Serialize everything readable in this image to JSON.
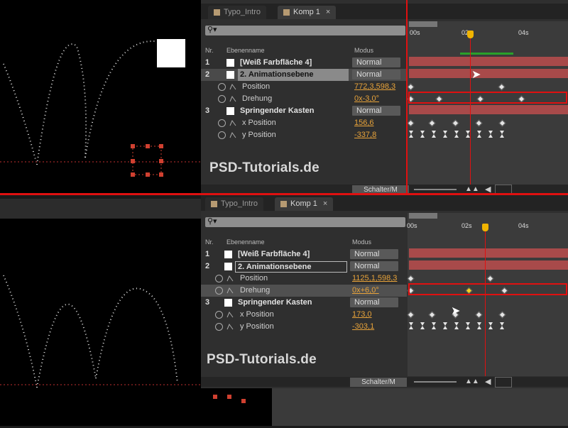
{
  "tabs": [
    "Typo_Intro",
    "Komp 1"
  ],
  "search_icon_text": "⚲▾",
  "columns": {
    "nr": "Nr.",
    "name": "Ebenenname",
    "mode": "Modus"
  },
  "ruler": [
    "00s",
    "02s",
    "04s"
  ],
  "layers_top": [
    {
      "num": "1",
      "name": "[Weiß Farbfläche 4]",
      "mode": "Normal"
    },
    {
      "num": "2",
      "name": "2. Animationsebene",
      "mode": "Normal"
    },
    {
      "prop": "Position",
      "value": "772,3,598,3"
    },
    {
      "prop": "Drehung",
      "value": "0x-3,0°"
    },
    {
      "num": "3",
      "name": "Springender Kasten",
      "mode": "Normal"
    },
    {
      "prop": "x Position",
      "value": "156,6"
    },
    {
      "prop": "y Position",
      "value": "-337,8"
    }
  ],
  "layers_bottom": [
    {
      "num": "1",
      "name": "[Weiß Farbfläche 4]",
      "mode": "Normal"
    },
    {
      "num": "2",
      "name": "2. Animationsebene",
      "mode": "Normal"
    },
    {
      "prop": "Position",
      "value": "1125,1,598,3"
    },
    {
      "prop": "Drehung",
      "value": "0x+6,0°"
    },
    {
      "num": "3",
      "name": "Springender Kasten",
      "mode": "Normal"
    },
    {
      "prop": "x Position",
      "value": "173,0"
    },
    {
      "prop": "y Position",
      "value": "-303,1"
    }
  ],
  "watermark": "PSD-Tutorials.de",
  "footer_button": "Schalter/M",
  "colors": {
    "accent": "#e8a33a",
    "redline": "#e01010",
    "layerbar": "#a84a4a",
    "cti": "#f0b400"
  }
}
